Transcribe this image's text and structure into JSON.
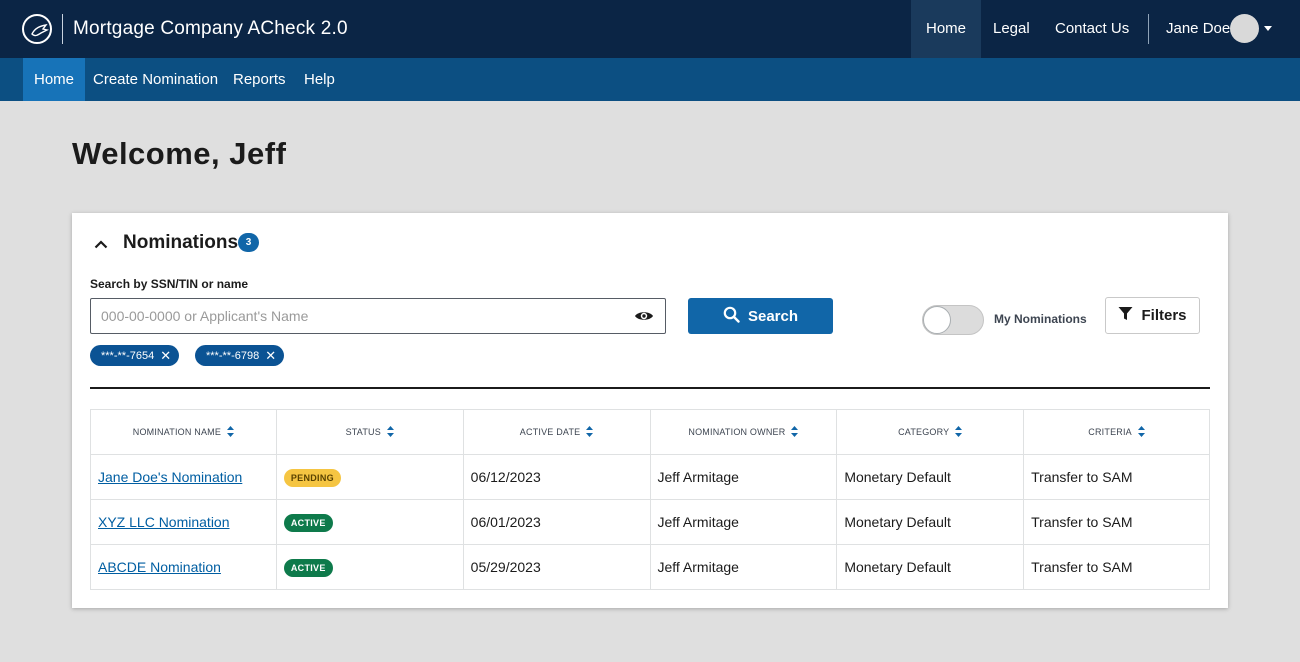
{
  "app": {
    "title": "Mortgage Company ACheck 2.0",
    "top_nav": [
      {
        "label": "Home"
      },
      {
        "label": "Legal"
      },
      {
        "label": "Contact Us"
      }
    ],
    "user": {
      "name": "Jane Doe"
    }
  },
  "sub_nav": [
    {
      "label": "Home"
    },
    {
      "label": "Create Nomination"
    },
    {
      "label": "Reports"
    },
    {
      "label": "Help"
    }
  ],
  "page": {
    "welcome": "Welcome, Jeff"
  },
  "nominations": {
    "title": "Nominations",
    "count": "3",
    "search": {
      "label": "Search by SSN/TIN or name",
      "placeholder": "000-00-0000 or Applicant's Name",
      "value": "",
      "button_label": "Search"
    },
    "my_nominations_label": "My Nominations",
    "my_nominations_on": false,
    "filters_label": "Filters",
    "chips": [
      {
        "label": "***-**-7654"
      },
      {
        "label": "***-**-6798"
      }
    ],
    "columns": [
      "NOMINATION NAME",
      "STATUS",
      "ACTIVE DATE",
      "NOMINATION OWNER",
      "CATEGORY",
      "CRITERIA"
    ],
    "rows": [
      {
        "name": "Jane Doe's Nomination",
        "status": "PENDING",
        "date": "06/12/2023",
        "owner": "Jeff Armitage",
        "category": "Monetary Default",
        "criteria": "Transfer to SAM"
      },
      {
        "name": "XYZ LLC Nomination",
        "status": "ACTIVE",
        "date": "06/01/2023",
        "owner": "Jeff Armitage",
        "category": "Monetary Default",
        "criteria": "Transfer to SAM"
      },
      {
        "name": "ABCDE Nomination",
        "status": "ACTIVE",
        "date": "05/29/2023",
        "owner": "Jeff Armitage",
        "category": "Monetary Default",
        "criteria": "Transfer to SAM"
      }
    ]
  },
  "colors": {
    "top_bar": "#0b2545",
    "sub_nav": "#0c4f82",
    "sub_nav_active": "#1773b8",
    "primary": "#1166a8",
    "pending": "#f5c542",
    "active": "#0e7a4b"
  }
}
